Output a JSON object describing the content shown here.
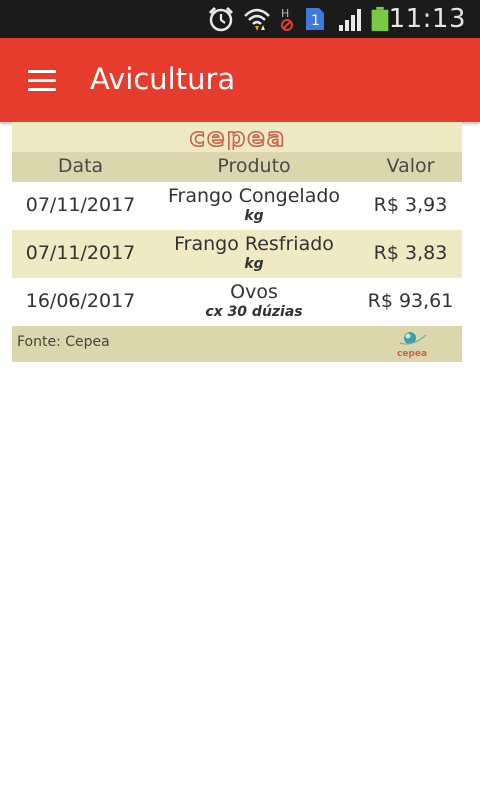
{
  "status_bar": {
    "time": "11:13",
    "icons": [
      "alarm-icon",
      "wifi-icon",
      "no-signal-h-icon",
      "sim-1-icon",
      "signal-icon",
      "battery-icon"
    ],
    "sim_number": "1"
  },
  "app_bar": {
    "title": "Avicultura",
    "color": "#e53c2e",
    "menu_icon": "hamburger-menu-icon"
  },
  "table": {
    "logo_text": "cepea",
    "headers": {
      "date": "Data",
      "product": "Produto",
      "value": "Valor"
    },
    "rows": [
      {
        "date": "07/11/2017",
        "product": "Frango Congelado",
        "unit": "kg",
        "value": "R$ 3,93"
      },
      {
        "date": "07/11/2017",
        "product": "Frango Resfriado",
        "unit": "kg",
        "value": "R$ 3,83"
      },
      {
        "date": "16/06/2017",
        "product": "Ovos",
        "unit": "cx 30 dúzias",
        "value": "R$ 93,61"
      }
    ],
    "footer": {
      "source": "Fonte: Cepea",
      "logo_text": "cepea"
    },
    "colors": {
      "light_row": "#efe9c4",
      "dark_row": "#dcd6ae"
    }
  }
}
